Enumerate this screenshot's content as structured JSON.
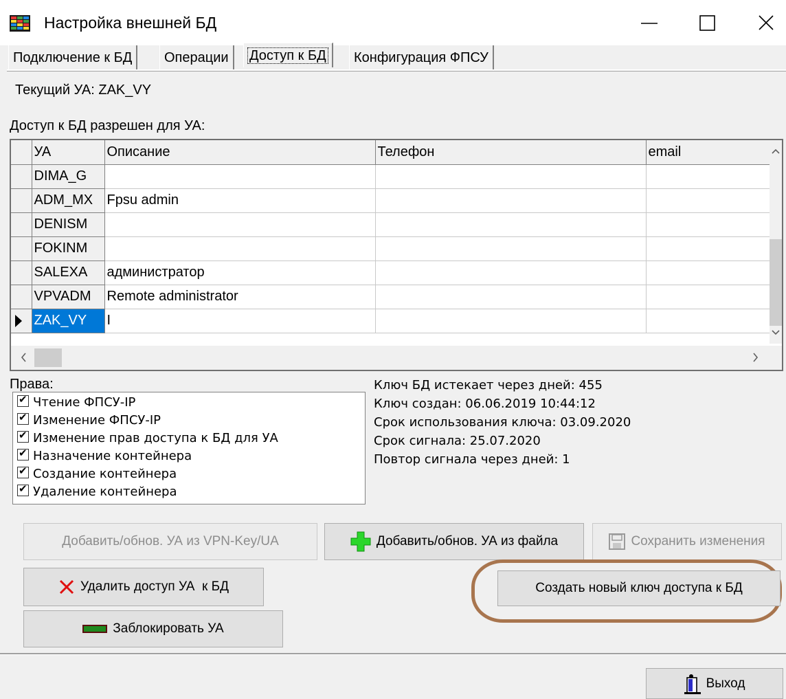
{
  "window": {
    "title": "Настройка внешней БД",
    "icon": "database-grid-icon",
    "controls": {
      "minimize": "—",
      "maximize": "☐",
      "close": "✕"
    }
  },
  "tabs": [
    {
      "label": "Подключение к БД",
      "active": false
    },
    {
      "label": "Операции",
      "active": false
    },
    {
      "label": "Доступ к БД",
      "active": true
    },
    {
      "label": "Конфигурация ФПСУ",
      "active": false
    }
  ],
  "current_ua": "Текущий УА: ZAK_VY",
  "access_label": "Доступ к БД разрешен для УА:",
  "grid": {
    "columns": [
      "УА",
      "Описание",
      "Телефон",
      "email"
    ],
    "rows": [
      {
        "ua": "DIMA_G",
        "description": "",
        "phone": "",
        "email": "",
        "selected": false
      },
      {
        "ua": "ADM_MX",
        "description": "Fpsu admin",
        "phone": "",
        "email": "",
        "selected": false
      },
      {
        "ua": "DENISM",
        "description": "",
        "phone": "",
        "email": "",
        "selected": false
      },
      {
        "ua": "FOKINM",
        "description": "",
        "phone": "",
        "email": "",
        "selected": false
      },
      {
        "ua": "SALEXA",
        "description": "администратор",
        "phone": "",
        "email": "",
        "selected": false
      },
      {
        "ua": "VPVADM",
        "description": "Remote administrator",
        "phone": "",
        "email": "",
        "selected": false
      },
      {
        "ua": "ZAK_VY",
        "description": "I",
        "phone": "",
        "email": "",
        "selected": true
      }
    ]
  },
  "rights": {
    "label": "Права:",
    "items": [
      {
        "label": "Чтение ФПСУ-IP",
        "checked": true
      },
      {
        "label": "Изменение ФПСУ-IP",
        "checked": true
      },
      {
        "label": "Изменение прав доступа к БД для УА",
        "checked": true
      },
      {
        "label": "Назначение контейнера",
        "checked": true
      },
      {
        "label": "Создание контейнера",
        "checked": true
      },
      {
        "label": "Удаление контейнера",
        "checked": true
      }
    ]
  },
  "key_info": [
    "Ключ БД истекает через дней: 455",
    "Ключ создан: 06.06.2019 10:44:12",
    "Срок использования ключа: 03.09.2020",
    "Срок сигнала: 25.07.2020",
    "Повтор сигнала через дней: 1"
  ],
  "buttons": {
    "add_from_vpn": "Добавить/обнов. УА из VPN-Key/UA",
    "add_from_file": "Добавить/обнов. УА из файла",
    "save_changes": "Сохранить изменения",
    "delete_access": "Удалить доступ УА  к БД",
    "create_key": "Создать новый ключ доступа к БД",
    "block_ua": "Заблокировать УА",
    "exit": "Выход"
  },
  "colors": {
    "selection": "#0078d7",
    "highlight_oval": "#a8754e",
    "add_icon": "#2bd62b",
    "delete_icon": "#e01010",
    "block_icon": "#6b1010"
  }
}
